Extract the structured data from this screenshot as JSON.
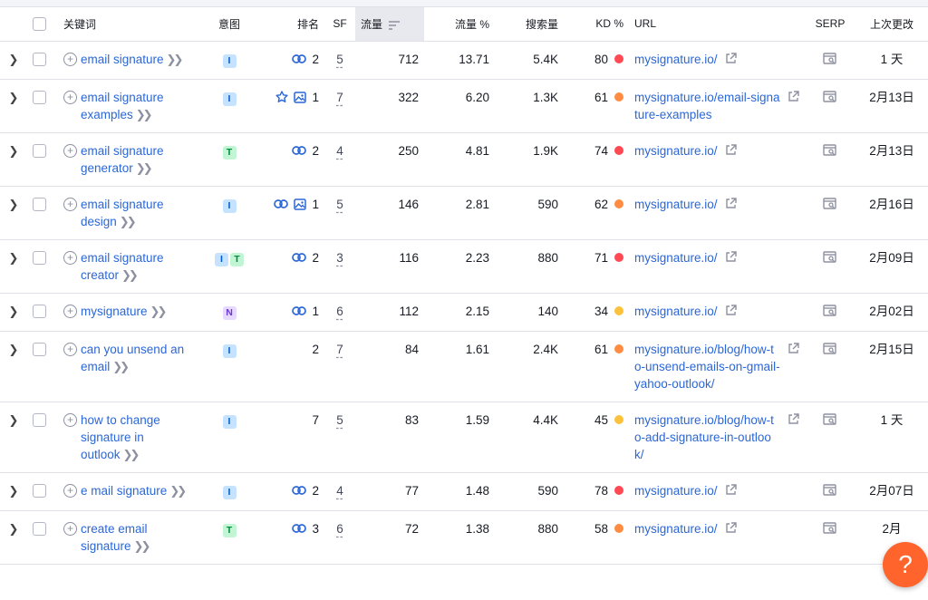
{
  "headers": {
    "keyword": "关键词",
    "intent": "意图",
    "position": "排名",
    "sf": "SF",
    "traffic": "流量",
    "traffic_pct": "流量 %",
    "volume": "搜索量",
    "kd": "KD %",
    "url": "URL",
    "serp": "SERP",
    "updated": "上次更改"
  },
  "colors": {
    "kd_red": "#ff4953",
    "kd_orange": "#ff8c43",
    "kd_yellow": "#fdc23c",
    "link": "#2b67d7",
    "help": "#ff642d"
  },
  "rows": [
    {
      "keyword": "email signature",
      "intents": [
        "I"
      ],
      "features": [
        "link"
      ],
      "position": "2",
      "sf": "5",
      "traffic": "712",
      "traffic_pct": "13.71",
      "volume": "5.4K",
      "kd": "80",
      "kd_level": "red",
      "url": "mysignature.io/",
      "updated": "1 天"
    },
    {
      "keyword": "email signature examples",
      "intents": [
        "I"
      ],
      "features": [
        "star",
        "image"
      ],
      "position": "1",
      "sf": "7",
      "traffic": "322",
      "traffic_pct": "6.20",
      "volume": "1.3K",
      "kd": "61",
      "kd_level": "orange",
      "url": "mysignature.io/email-signature-examples",
      "updated": "2月13日"
    },
    {
      "keyword": "email signature generator",
      "intents": [
        "T"
      ],
      "features": [
        "link"
      ],
      "position": "2",
      "sf": "4",
      "traffic": "250",
      "traffic_pct": "4.81",
      "volume": "1.9K",
      "kd": "74",
      "kd_level": "red",
      "url": "mysignature.io/",
      "updated": "2月13日"
    },
    {
      "keyword": "email signature design",
      "intents": [
        "I"
      ],
      "features": [
        "link",
        "image"
      ],
      "position": "1",
      "sf": "5",
      "traffic": "146",
      "traffic_pct": "2.81",
      "volume": "590",
      "kd": "62",
      "kd_level": "orange",
      "url": "mysignature.io/",
      "updated": "2月16日"
    },
    {
      "keyword": "email signature creator",
      "intents": [
        "I",
        "T"
      ],
      "features": [
        "link"
      ],
      "position": "2",
      "sf": "3",
      "traffic": "116",
      "traffic_pct": "2.23",
      "volume": "880",
      "kd": "71",
      "kd_level": "red",
      "url": "mysignature.io/",
      "updated": "2月09日"
    },
    {
      "keyword": "mysignature",
      "intents": [
        "N"
      ],
      "features": [
        "link"
      ],
      "position": "1",
      "sf": "6",
      "traffic": "112",
      "traffic_pct": "2.15",
      "volume": "140",
      "kd": "34",
      "kd_level": "yellow",
      "url": "mysignature.io/",
      "updated": "2月02日"
    },
    {
      "keyword": "can you unsend an email",
      "intents": [
        "I"
      ],
      "features": [],
      "position": "2",
      "sf": "7",
      "traffic": "84",
      "traffic_pct": "1.61",
      "volume": "2.4K",
      "kd": "61",
      "kd_level": "orange",
      "url": "mysignature.io/blog/how-to-unsend-emails-on-gmail-yahoo-outlook/",
      "updated": "2月15日"
    },
    {
      "keyword": "how to change signature in outlook",
      "intents": [
        "I"
      ],
      "features": [],
      "position": "7",
      "sf": "5",
      "traffic": "83",
      "traffic_pct": "1.59",
      "volume": "4.4K",
      "kd": "45",
      "kd_level": "yellow",
      "url": "mysignature.io/blog/how-to-add-signature-in-outlook/",
      "updated": "1 天"
    },
    {
      "keyword": "e mail signature",
      "intents": [
        "I"
      ],
      "features": [
        "link"
      ],
      "position": "2",
      "sf": "4",
      "traffic": "77",
      "traffic_pct": "1.48",
      "volume": "590",
      "kd": "78",
      "kd_level": "red",
      "url": "mysignature.io/",
      "updated": "2月07日"
    },
    {
      "keyword": "create email signature",
      "intents": [
        "T"
      ],
      "features": [
        "link"
      ],
      "position": "3",
      "sf": "6",
      "traffic": "72",
      "traffic_pct": "1.38",
      "volume": "880",
      "kd": "58",
      "kd_level": "orange",
      "url": "mysignature.io/",
      "updated": "2月"
    }
  ],
  "help_label": "?"
}
